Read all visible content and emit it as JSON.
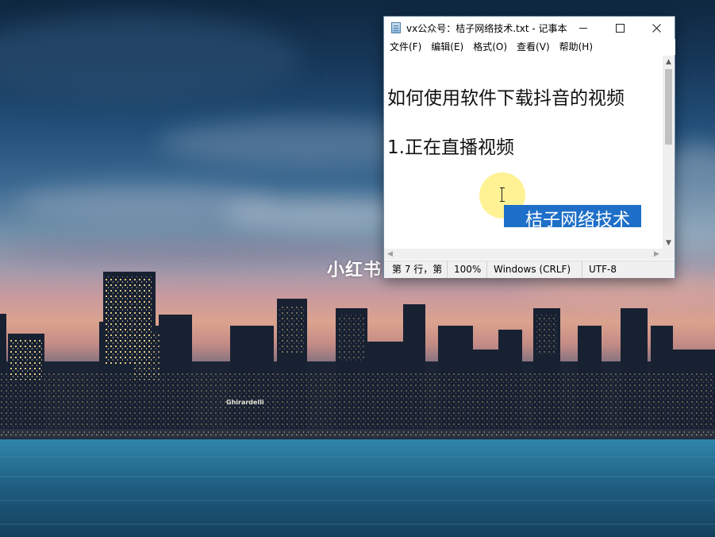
{
  "desktop": {
    "watermark": "小红书"
  },
  "notepad": {
    "title": "vx公众号：桔子网络技术.txt - 记事本",
    "menu": [
      {
        "label": "文件(F)"
      },
      {
        "label": "编辑(E)"
      },
      {
        "label": "格式(O)"
      },
      {
        "label": "查看(V)"
      },
      {
        "label": "帮助(H)"
      }
    ],
    "content": {
      "line1": "如何使用软件下载抖音的视频",
      "line2": "1.正在直播视频",
      "selected": "桔子网络技术"
    },
    "status": {
      "position": "第 7 行，第",
      "zoom": "100%",
      "line_ending": "Windows (CRLF)",
      "encoding": "UTF-8"
    },
    "colors": {
      "selection": "#1e6fc8",
      "cursor_highlight": "#fff082"
    }
  }
}
